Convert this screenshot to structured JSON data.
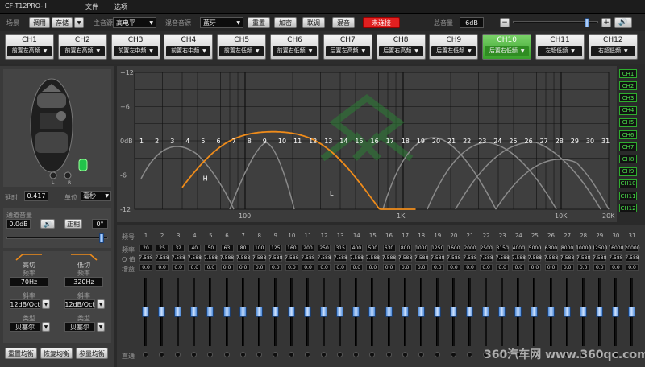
{
  "window": {
    "title": "CF-T12PRO-II"
  },
  "menu": [
    "文件",
    "选项"
  ],
  "toolbar": {
    "scene_label": "场景",
    "load": "调用",
    "save": "存储",
    "main_source_label": "主音源",
    "main_source_value": "高电平",
    "mix_source_label": "混音音源",
    "mix_source_value": "蓝牙",
    "reset": "重置",
    "encrypt": "加密",
    "link": "联调",
    "mix": "混音",
    "status": "未连接",
    "total_volume_label": "总音量",
    "total_volume_value": "6dB",
    "total_volume_level": 0.88,
    "minus": "−",
    "plus": "+",
    "colors": {
      "status_bg": "#e02020",
      "active": "#3aa82c"
    }
  },
  "channels": [
    {
      "name": "CH1",
      "sub": "前置左高频"
    },
    {
      "name": "CH2",
      "sub": "前置右高频"
    },
    {
      "name": "CH3",
      "sub": "前置左中频"
    },
    {
      "name": "CH4",
      "sub": "前置右中频"
    },
    {
      "name": "CH5",
      "sub": "前置左低频"
    },
    {
      "name": "CH6",
      "sub": "前置右低频"
    },
    {
      "name": "CH7",
      "sub": "后置左高频"
    },
    {
      "name": "CH8",
      "sub": "后置右高频"
    },
    {
      "name": "CH9",
      "sub": "后置左低频"
    },
    {
      "name": "CH10",
      "sub": "后置右低频",
      "active": true
    },
    {
      "name": "CH11",
      "sub": "左超低频"
    },
    {
      "name": "CH12",
      "sub": "右超低频"
    }
  ],
  "left": {
    "car_left": "L",
    "car_right": "R",
    "delay_label": "延时",
    "delay_value": "0.417",
    "unit_label": "单位",
    "unit_value": "毫秒",
    "channel_volume_label": "通道音量",
    "channel_volume_value": "0.0dB",
    "phase_button": "正相",
    "phase_value": "0°",
    "channel_volume_level": 0.95,
    "hp_label": "高切",
    "lp_label": "低切",
    "freq_label": "频率",
    "hp_freq": "70Hz",
    "lp_freq": "320Hz",
    "slope_label": "斜率",
    "hp_slope": "12dB/Oct",
    "lp_slope": "12dB/Oct",
    "type_label": "类型",
    "hp_type": "贝塞尔",
    "lp_type": "贝塞尔",
    "buttons": [
      "重置均衡",
      "恢复均衡",
      "参量均衡"
    ]
  },
  "chart_data": {
    "type": "line",
    "y_ticks": [
      "+12",
      "+6",
      "0dB",
      "-6",
      "-12"
    ],
    "ylim": [
      -12,
      12
    ],
    "x_ticks": [
      "100",
      "1K",
      "10K",
      "20K"
    ],
    "x_scale": "log",
    "band_numbers": [
      "1",
      "2",
      "3",
      "4",
      "5",
      "6",
      "7",
      "8",
      "9",
      "10",
      "11",
      "12",
      "13",
      "14",
      "15",
      "16",
      "17",
      "18",
      "19",
      "20",
      "21",
      "22",
      "23",
      "24",
      "25",
      "26",
      "27",
      "28",
      "29",
      "30",
      "31"
    ],
    "annotations": [
      "H",
      "L"
    ],
    "series": [
      {
        "color": "#f08c1a",
        "highpass_hz": 70,
        "lowpass_hz": 320
      },
      {
        "color": "#8a8a8a"
      }
    ],
    "grid": true,
    "channel_tags": [
      "CH1",
      "CH2",
      "CH3",
      "CH4",
      "CH5",
      "CH6",
      "CH7",
      "CH8",
      "CH9",
      "CH10",
      "CH11",
      "CH12"
    ]
  },
  "eq_table": {
    "row_labels": {
      "band": "频号",
      "freq": "频率",
      "q": "Q 值",
      "gain": "增益",
      "bypass": "直通"
    },
    "bands": [
      "1",
      "2",
      "3",
      "4",
      "5",
      "6",
      "7",
      "8",
      "9",
      "10",
      "11",
      "12",
      "13",
      "14",
      "15",
      "16",
      "17",
      "18",
      "19",
      "20",
      "21",
      "22",
      "23",
      "24",
      "25",
      "26",
      "27",
      "28",
      "29",
      "30",
      "31"
    ],
    "freqs": [
      "20",
      "25",
      "32",
      "40",
      "50",
      "63",
      "80",
      "100",
      "125",
      "160",
      "200",
      "250",
      "315",
      "400",
      "500",
      "630",
      "800",
      "1000",
      "1250",
      "1600",
      "2000",
      "2500",
      "3150",
      "4000",
      "5000",
      "6300",
      "8000",
      "10000",
      "12500",
      "16000",
      "20000"
    ],
    "q_values": [
      "7.588",
      "7.588",
      "7.588",
      "7.588",
      "7.588",
      "7.588",
      "7.588",
      "7.588",
      "7.588",
      "7.588",
      "7.588",
      "7.588",
      "7.588",
      "7.588",
      "7.588",
      "7.588",
      "7.588",
      "7.588",
      "7.588",
      "7.588",
      "7.588",
      "7.588",
      "7.588",
      "7.588",
      "7.588",
      "7.588",
      "7.588",
      "7.588",
      "7.588",
      "7.588",
      "7.588"
    ],
    "gains": [
      "0.0",
      "0.0",
      "0.0",
      "0.0",
      "0.0",
      "0.0",
      "0.0",
      "0.0",
      "0.0",
      "0.0",
      "0.0",
      "0.0",
      "0.0",
      "0.0",
      "0.0",
      "0.0",
      "0.0",
      "0.0",
      "0.0",
      "0.0",
      "0.0",
      "0.0",
      "0.0",
      "0.0",
      "0.0",
      "0.0",
      "0.0",
      "0.0",
      "0.0",
      "0.0",
      "0.0"
    ]
  },
  "watermark": "360汽车网 www.360qc.com"
}
